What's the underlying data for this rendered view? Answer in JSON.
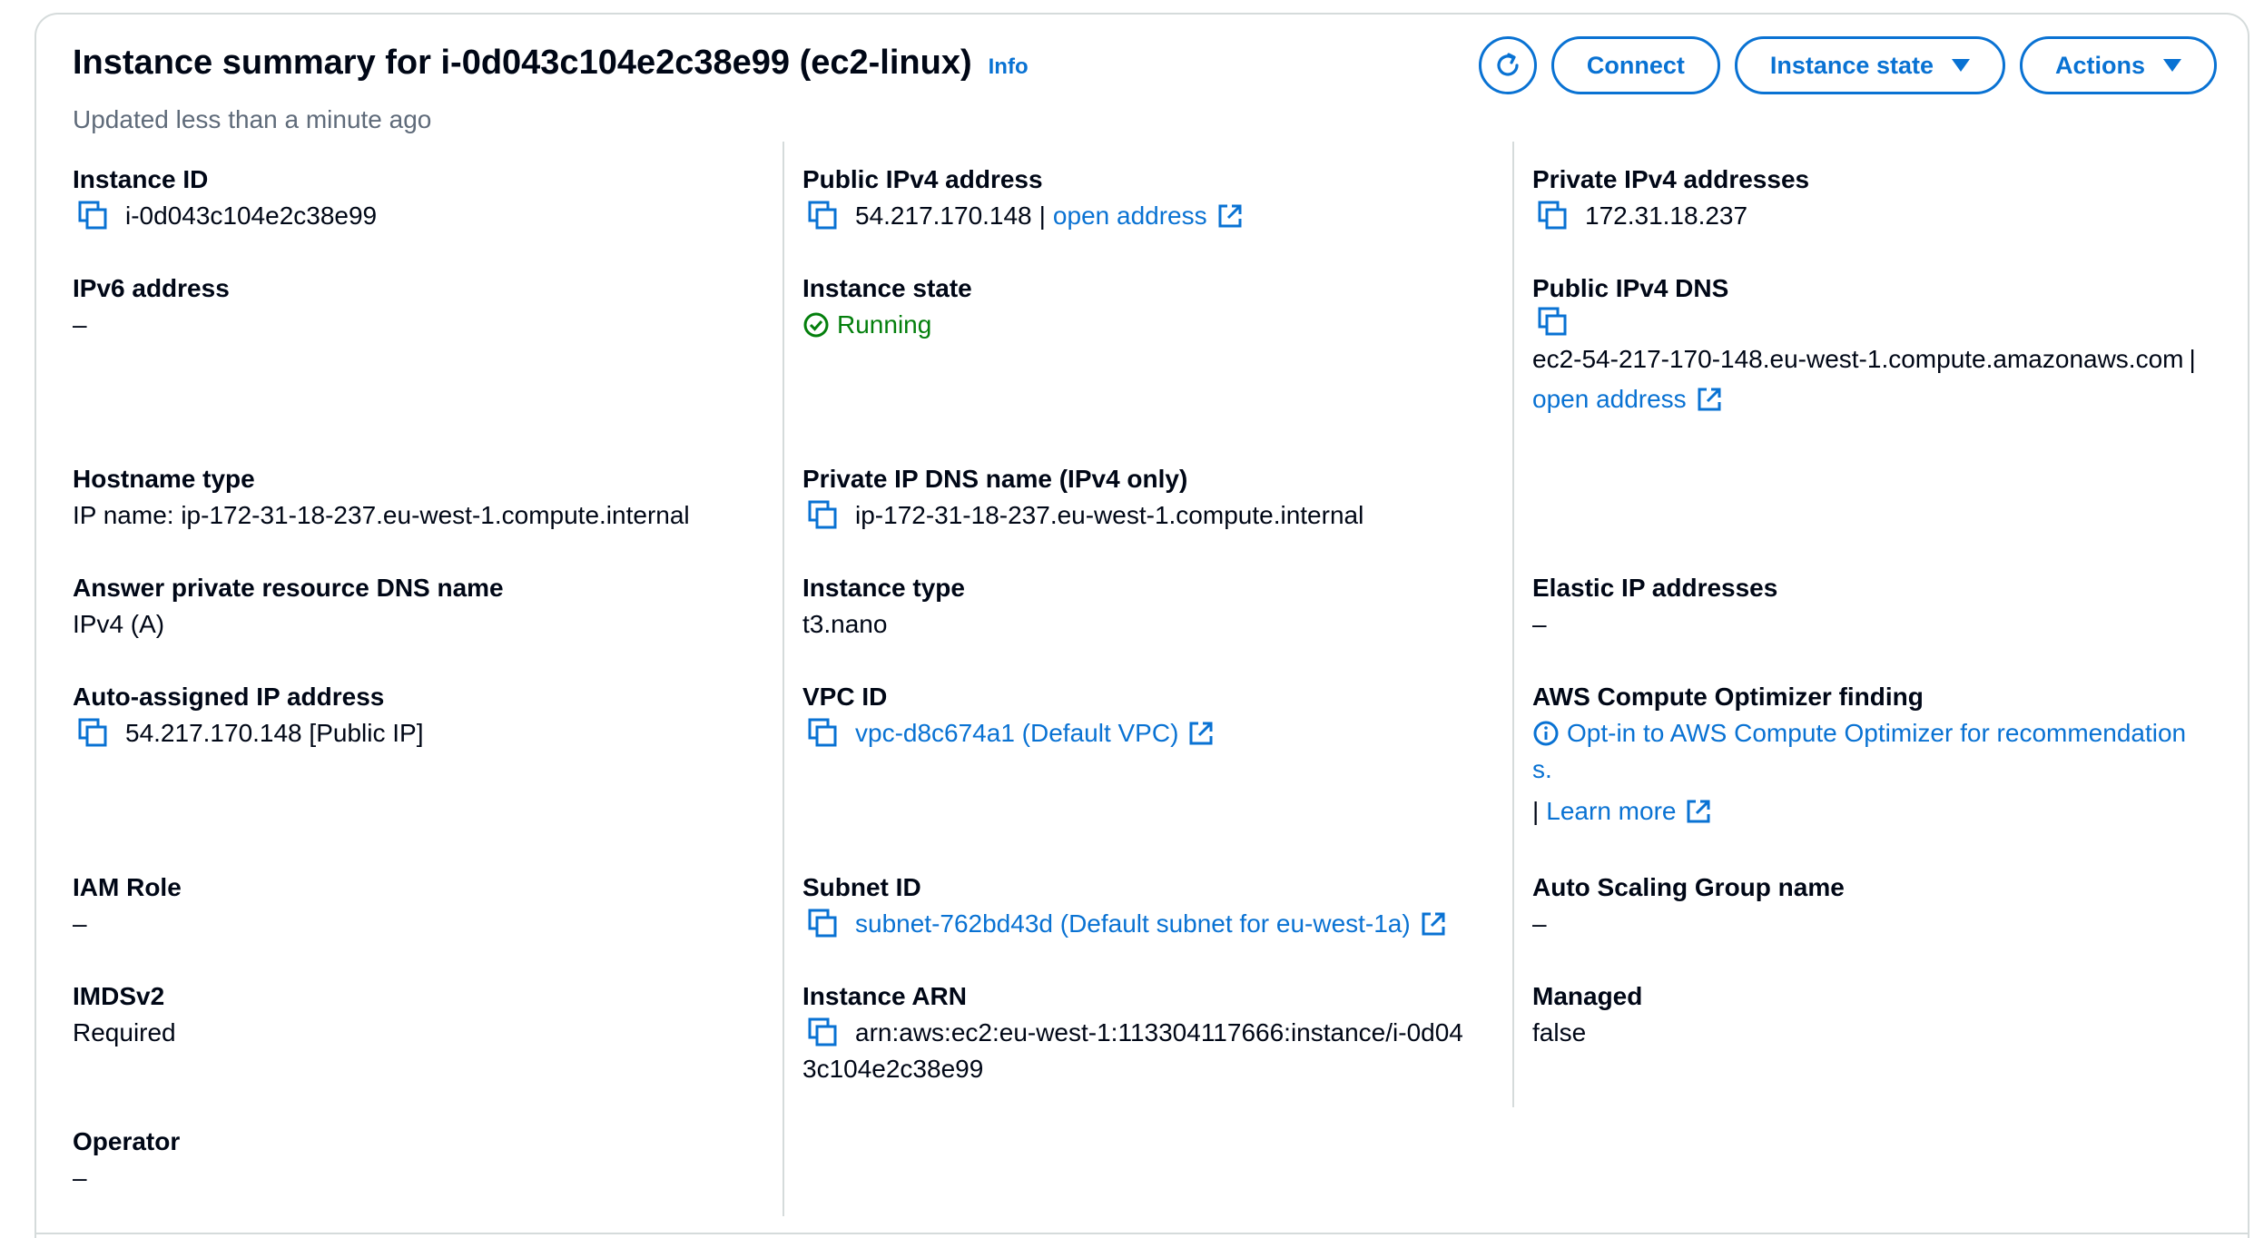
{
  "header": {
    "title": "Instance summary for i-0d043c104e2c38e99 (ec2-linux)",
    "info": "Info",
    "updated": "Updated less than a minute ago"
  },
  "toolbar": {
    "refresh_icon": "refresh-icon",
    "connect": "Connect",
    "instance_state": "Instance state",
    "actions": "Actions"
  },
  "col1": {
    "instance_id_label": "Instance ID",
    "instance_id": "i-0d043c104e2c38e99",
    "ipv6_label": "IPv6 address",
    "ipv6": "–",
    "hostname_type_label": "Hostname type",
    "hostname_type": "IP name: ip-172-31-18-237.eu-west-1.compute.internal",
    "answer_dns_label": "Answer private resource DNS name",
    "answer_dns": "IPv4 (A)",
    "auto_ip_label": "Auto-assigned IP address",
    "auto_ip": "54.217.170.148 [Public IP]",
    "iam_label": "IAM Role",
    "iam": "–",
    "imds_label": "IMDSv2",
    "imds": "Required",
    "operator_label": "Operator",
    "operator": "–"
  },
  "col2": {
    "public_ipv4_label": "Public IPv4 address",
    "public_ipv4": "54.217.170.148",
    "separator": "|",
    "open_address": "open address",
    "state_label": "Instance state",
    "state": "Running",
    "private_dns_label": "Private IP DNS name (IPv4 only)",
    "private_dns": "ip-172-31-18-237.eu-west-1.compute.internal",
    "type_label": "Instance type",
    "type": "t3.nano",
    "vpc_label": "VPC ID",
    "vpc": "vpc-d8c674a1 (Default VPC)",
    "subnet_label": "Subnet ID",
    "subnet": "subnet-762bd43d (Default subnet for eu-west-1a)",
    "arn_label": "Instance ARN",
    "arn_line1": "arn:aws:ec2:eu-west-1:113304117666:instance/i-0d04",
    "arn_line2": "3c104e2c38e99"
  },
  "col3": {
    "private_ipv4_label": "Private IPv4 addresses",
    "private_ipv4": "172.31.18.237",
    "public_dns_label": "Public IPv4 DNS",
    "public_dns": "ec2-54-217-170-148.eu-west-1.compute.amazonaws.com",
    "separator": "|",
    "open_address": "open address",
    "elastic_label": "Elastic IP addresses",
    "elastic": "–",
    "optimizer_label": "AWS Compute Optimizer finding",
    "optimizer_line1": "Opt-in to AWS Compute Optimizer for recommendation",
    "optimizer_line2": "s.",
    "learn_more": "Learn more",
    "asg_label": "Auto Scaling Group name",
    "asg": "–",
    "managed_label": "Managed",
    "managed": "false"
  }
}
